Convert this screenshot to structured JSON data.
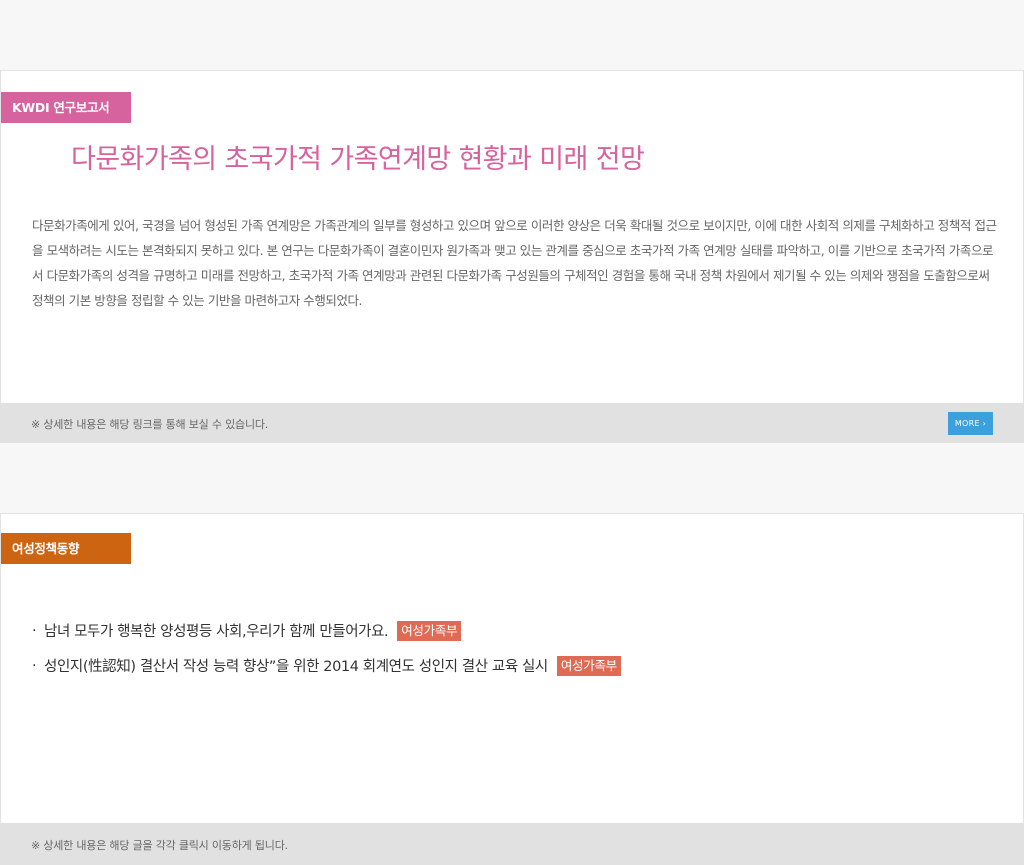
{
  "colors": {
    "report_accent": "#d6629e",
    "policy_accent": "#cd6412",
    "badge_bg": "#e06b55",
    "more_button": "#3aa1de"
  },
  "report": {
    "tag": "KWDI 연구보고서",
    "title": "다문화가족의 초국가적 가족연계망 현황과 미래 전망",
    "body": "다문화가족에게 있어, 국경을 넘어 형성된 가족 연계망은 가족관계의 일부를 형성하고 있으며 앞으로 이러한 양상은 더욱 확대될 것으로 보이지만, 이에 대한 사회적 의제를 구체화하고 정책적 접근을 모색하려는 시도는 본격화되지 못하고 있다. 본 연구는 다문화가족이 결혼이민자 원가족과 맺고 있는 관계를 중심으로 초국가적 가족 연계망 실태를 파악하고, 이를 기반으로 초국가적 가족으로서 다문화가족의 성격을 규명하고 미래를 전망하고,  초국가적 가족 연계망과 관련된 다문화가족 구성원들의 구체적인 경험을 통해 국내 정책 차원에서 제기될 수 있는 의제와 쟁점을 도출함으로써 정책의 기본 방향을 정립할 수 있는 기반을 마련하고자 수행되었다.",
    "footer_note": "※ 상세한 내용은 해당 링크를 통해 보실 수 있습니다.",
    "more_label": "MORE ›"
  },
  "policy": {
    "tag": "여성정책동향",
    "items": [
      {
        "bullet": "·",
        "text": "남녀 모두가 행복한 양성평등 사회,우리가 함께 만들어가요.",
        "badge": "여성가족부"
      },
      {
        "bullet": "·",
        "text": "성인지(性認知) 결산서 작성 능력 향상”을 위한 2014 회계연도 성인지 결산 교육 실시",
        "badge": "여성가족부"
      }
    ],
    "footer_note": "※ 상세한 내용은 해당 글을 각각 클릭시 이동하게 됩니다."
  }
}
